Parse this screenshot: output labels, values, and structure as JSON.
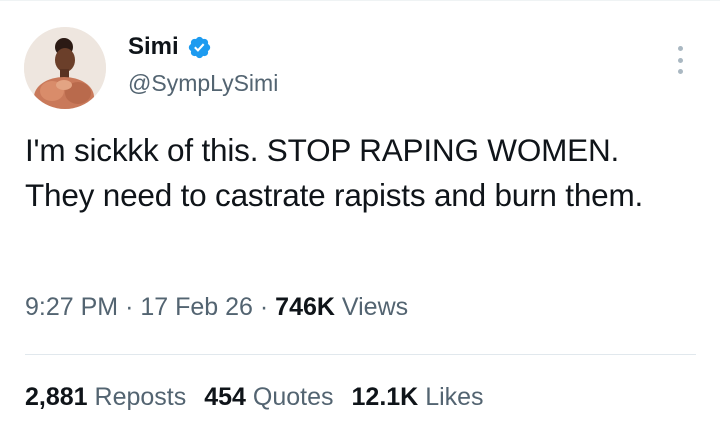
{
  "author": {
    "display_name": "Simi",
    "handle": "@SympLySimi",
    "verified": true
  },
  "tweet": {
    "text": "I'm sickkk of this. STOP RAPING WOMEN. They need to castrate rapists and burn them."
  },
  "meta": {
    "time": "9:27 PM",
    "separator": "·",
    "date": "17 Feb 26",
    "views_count": "746K",
    "views_label": "Views"
  },
  "stats": {
    "reposts_count": "2,881",
    "reposts_label": "Reposts",
    "quotes_count": "454",
    "quotes_label": "Quotes",
    "likes_count": "12.1K",
    "likes_label": "Likes"
  },
  "colors": {
    "verified_badge": "#1d9bf0",
    "secondary_text": "#536471",
    "primary_text": "#0f1419"
  }
}
